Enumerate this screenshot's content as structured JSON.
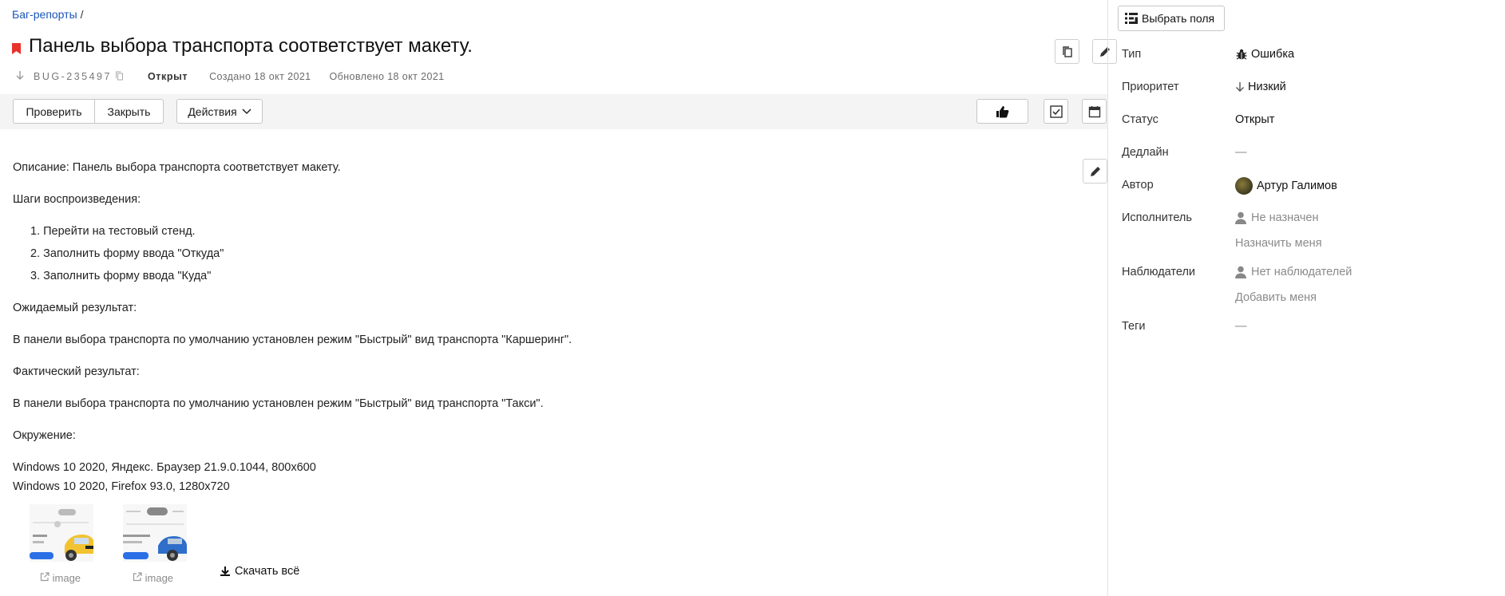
{
  "breadcrumb": {
    "link": "Баг-репорты",
    "separator": "/"
  },
  "issue": {
    "title": "Панель выбора транспорта соответствует макету.",
    "key": "BUG-235497",
    "status": "Открыт",
    "created": "Создано 18 окт 2021",
    "updated": "Обновлено 18 окт 2021"
  },
  "toolbar": {
    "check_label": "Проверить",
    "close_label": "Закрыть",
    "actions_label": "Действия"
  },
  "description": {
    "line1": "Описание: Панель выбора транспорта соответствует макету.",
    "steps_title": "Шаги воспроизведения:",
    "steps": [
      "Перейти на тестовый стенд.",
      "Заполнить форму ввода \"Откуда\"",
      "Заполнить форму ввода \"Куда\""
    ],
    "expected_title": "Ожидаемый результат:",
    "expected": "В панели выбора транспорта по умолчанию установлен режим \"Быстрый\" вид транспорта \"Каршеринг\".",
    "actual_title": "Фактический результат:",
    "actual": "В панели выбора транспорта по умолчанию установлен режим \"Быстрый\" вид транспорта \"Такси\".",
    "env_title": "Окружение:",
    "env1": "Windows 10 2020, Яндекс. Браузер 21.9.0.1044, 800x600",
    "env2": "Windows 10 2020, Firefox 93.0, 1280x720"
  },
  "attachments": {
    "items": [
      {
        "label": "image"
      },
      {
        "label": "image"
      }
    ],
    "download_all": "Скачать всё"
  },
  "sidebar": {
    "select_fields": "Выбрать поля",
    "type_label": "Тип",
    "type_value": "Ошибка",
    "priority_label": "Приоритет",
    "priority_value": "Низкий",
    "status_label": "Статус",
    "status_value": "Открыт",
    "deadline_label": "Дедлайн",
    "deadline_value": "—",
    "author_label": "Автор",
    "author_value": "Артур Галимов",
    "assignee_label": "Исполнитель",
    "assignee_value": "Не назначен",
    "assign_me": "Назначить меня",
    "watchers_label": "Наблюдатели",
    "watchers_value": "Нет наблюдателей",
    "add_me": "Добавить меня",
    "tags_label": "Теги",
    "tags_value": "—"
  },
  "colors": {
    "flag": "#e8332a",
    "link": "#1a56b8",
    "toolbar_bg": "#f4f4f4",
    "muted": "#8a8a8a"
  }
}
